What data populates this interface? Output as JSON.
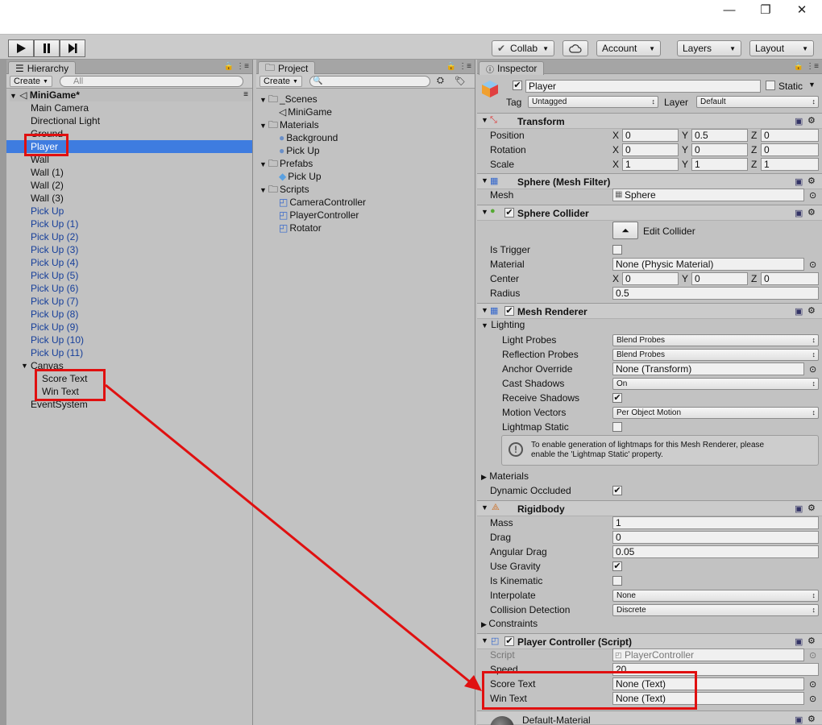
{
  "window": {
    "minimize": "—",
    "restore": "❐",
    "close": "✕"
  },
  "toolbar": {
    "collab": "Collab",
    "account": "Account",
    "layers": "Layers",
    "layout": "Layout"
  },
  "hierarchy": {
    "tab": "Hierarchy",
    "create": "Create",
    "search_placeholder": "All",
    "scene": "MiniGame*",
    "items": [
      "Main Camera",
      "Directional Light",
      "Ground",
      "Player",
      "Wall",
      "Wall (1)",
      "Wall (2)",
      "Wall (3)",
      "Pick Up",
      "Pick Up (1)",
      "Pick Up (2)",
      "Pick Up (3)",
      "Pick Up (4)",
      "Pick Up (5)",
      "Pick Up (6)",
      "Pick Up (7)",
      "Pick Up (8)",
      "Pick Up (9)",
      "Pick Up (10)",
      "Pick Up (11)",
      "Canvas",
      "Score Text",
      "Win Text",
      "EventSystem"
    ]
  },
  "project": {
    "tab": "Project",
    "create": "Create",
    "items": [
      "_Scenes",
      "MiniGame",
      "Materials",
      "Background",
      "Pick Up",
      "Prefabs",
      "Pick Up",
      "Scripts",
      "CameraController",
      "PlayerController",
      "Rotator"
    ]
  },
  "inspector": {
    "tab": "Inspector",
    "name": "Player",
    "static": "Static",
    "tag_label": "Tag",
    "tag": "Untagged",
    "layer_label": "Layer",
    "layer": "Default",
    "transform": {
      "title": "Transform",
      "position": "Position",
      "rotation": "Rotation",
      "scale": "Scale",
      "x": "X",
      "y": "Y",
      "z": "Z",
      "pos": [
        "0",
        "0.5",
        "0"
      ],
      "rot": [
        "0",
        "0",
        "0"
      ],
      "scl": [
        "1",
        "1",
        "1"
      ]
    },
    "meshfilter": {
      "title": "Sphere (Mesh Filter)",
      "mesh_label": "Mesh",
      "mesh": "Sphere"
    },
    "collider": {
      "title": "Sphere Collider",
      "edit": "Edit Collider",
      "is_trigger": "Is Trigger",
      "material_label": "Material",
      "material": "None (Physic Material)",
      "center": "Center",
      "center_vals": [
        "0",
        "0",
        "0"
      ],
      "radius_label": "Radius",
      "radius": "0.5"
    },
    "renderer": {
      "title": "Mesh Renderer",
      "lighting": "Lighting",
      "light_probes": "Light Probes",
      "light_probes_val": "Blend Probes",
      "reflection_probes": "Reflection Probes",
      "reflection_probes_val": "Blend Probes",
      "anchor": "Anchor Override",
      "anchor_val": "None (Transform)",
      "cast": "Cast Shadows",
      "cast_val": "On",
      "receive": "Receive Shadows",
      "motion": "Motion Vectors",
      "motion_val": "Per Object Motion",
      "lightmap": "Lightmap Static",
      "info_line1": "To enable generation of lightmaps for this Mesh Renderer, please",
      "info_line2": "enable the 'Lightmap Static' property.",
      "materials": "Materials",
      "dynamic": "Dynamic Occluded"
    },
    "rigidbody": {
      "title": "Rigidbody",
      "mass": "Mass",
      "mass_val": "1",
      "drag": "Drag",
      "drag_val": "0",
      "angular": "Angular Drag",
      "angular_val": "0.05",
      "gravity": "Use Gravity",
      "kinematic": "Is Kinematic",
      "interpolate": "Interpolate",
      "interpolate_val": "None",
      "collision": "Collision Detection",
      "collision_val": "Discrete",
      "constraints": "Constraints"
    },
    "script": {
      "title": "Player Controller (Script)",
      "script_label": "Script",
      "script_val": "PlayerController",
      "speed": "Speed",
      "speed_val": "20",
      "score": "Score Text",
      "score_val": "None (Text)",
      "win": "Win Text",
      "win_val": "None (Text)"
    },
    "material": {
      "name": "Default-Material"
    }
  },
  "colors": {
    "arrow": "#e01010",
    "selection": "#3e7ce0"
  }
}
